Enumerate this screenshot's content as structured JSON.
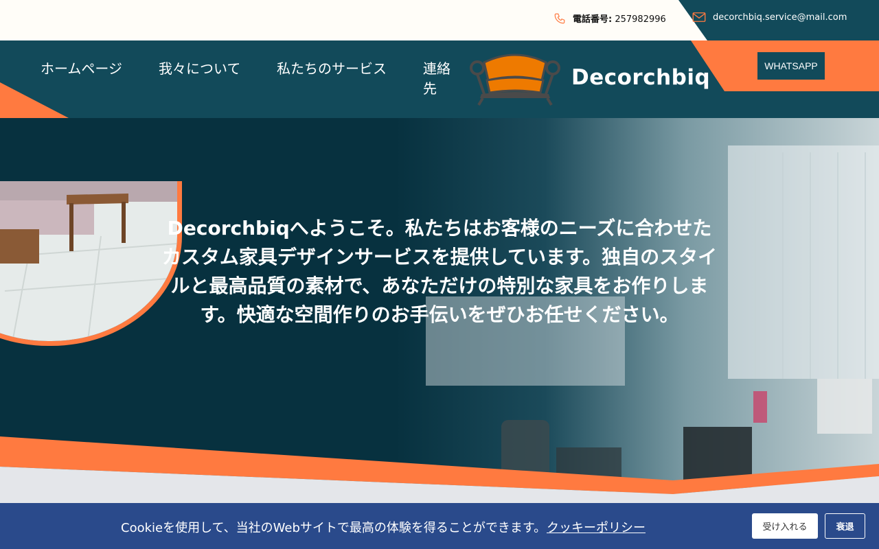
{
  "header": {
    "phone_label": "電話番号:",
    "phone_number": "257982996",
    "email": "decorchbiq.service@mail.com"
  },
  "nav": {
    "items": [
      {
        "label": "ホームページ"
      },
      {
        "label": "我々について"
      },
      {
        "label": "私たちのサービス"
      },
      {
        "label": "連絡先"
      }
    ],
    "brand": "Decorchbiq",
    "whatsapp_label": "WHATSAPP"
  },
  "hero": {
    "text": "Decorchbiqへようこそ。私たちはお客様のニーズに合わせたカスタム家具デザインサービスを提供しています。独自のスタイルと最高品質の素材で、あなただけの特別な家具をお作りします。快適な空間作りのお手伝いをぜひお任せください。"
  },
  "cookie": {
    "message": "Cookieを使用して、当社のWebサイトで最高の体験を得ることができます。",
    "policy_link": "クッキーポリシー",
    "accept_label": "受け入れる",
    "decline_label": "衰退"
  },
  "colors": {
    "primary": "#124a5a",
    "accent": "#ff7a40",
    "cookie_bg": "#2a4a8b"
  },
  "icons": {
    "phone": "phone-icon",
    "mail": "mail-icon",
    "logo": "sofa-logo-icon"
  }
}
